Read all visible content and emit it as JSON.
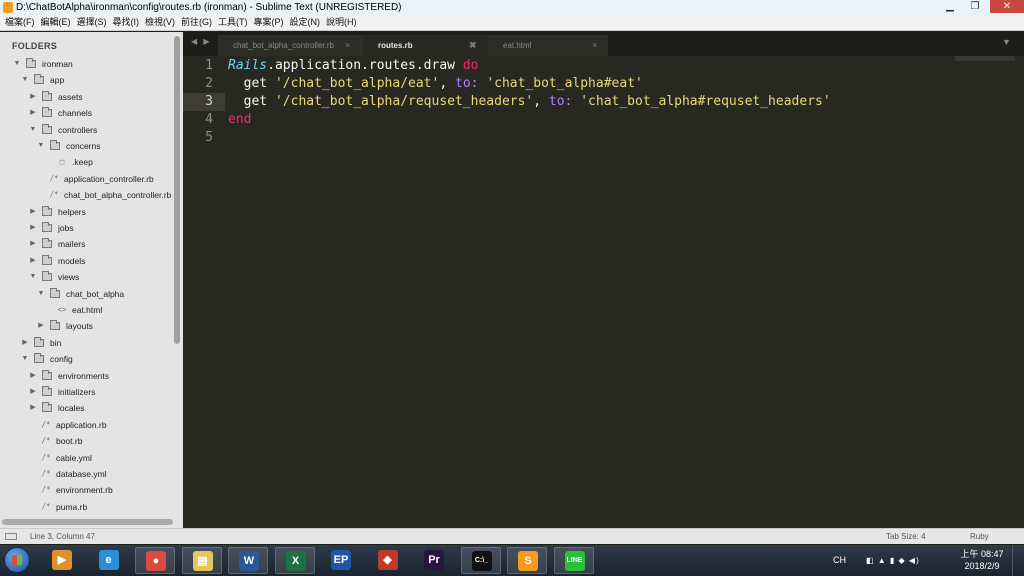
{
  "window": {
    "title": "D:\\ChatBotAlpha\\ironman\\config\\routes.rb (ironman) - Sublime Text (UNREGISTERED)",
    "minimize": "▁",
    "maximize": "❐",
    "close": "✕"
  },
  "menu": [
    "檔案(F)",
    "編輯(E)",
    "選擇(S)",
    "尋找(I)",
    "檢視(V)",
    "前往(G)",
    "工具(T)",
    "專案(P)",
    "設定(N)",
    "說明(H)"
  ],
  "sidebar": {
    "header": "FOLDERS",
    "tree": [
      {
        "label": "ironman",
        "depth": 0,
        "kind": "folder",
        "expanded": true
      },
      {
        "label": "app",
        "depth": 1,
        "kind": "folder",
        "expanded": true
      },
      {
        "label": "assets",
        "depth": 2,
        "kind": "folder",
        "expanded": false
      },
      {
        "label": "channels",
        "depth": 2,
        "kind": "folder",
        "expanded": false
      },
      {
        "label": "controllers",
        "depth": 2,
        "kind": "folder",
        "expanded": true
      },
      {
        "label": "concerns",
        "depth": 3,
        "kind": "folder",
        "expanded": true
      },
      {
        "label": ".keep",
        "depth": 4,
        "kind": "file",
        "icon": "□"
      },
      {
        "label": "application_controller.rb",
        "depth": 3,
        "kind": "file",
        "icon": "/*"
      },
      {
        "label": "chat_bot_alpha_controller.rb",
        "depth": 3,
        "kind": "file",
        "icon": "/*"
      },
      {
        "label": "helpers",
        "depth": 2,
        "kind": "folder",
        "expanded": false
      },
      {
        "label": "jobs",
        "depth": 2,
        "kind": "folder",
        "expanded": false
      },
      {
        "label": "mailers",
        "depth": 2,
        "kind": "folder",
        "expanded": false
      },
      {
        "label": "models",
        "depth": 2,
        "kind": "folder",
        "expanded": false
      },
      {
        "label": "views",
        "depth": 2,
        "kind": "folder",
        "expanded": true
      },
      {
        "label": "chat_bot_alpha",
        "depth": 3,
        "kind": "folder",
        "expanded": true
      },
      {
        "label": "eat.html",
        "depth": 4,
        "kind": "file",
        "icon": "<>"
      },
      {
        "label": "layouts",
        "depth": 3,
        "kind": "folder",
        "expanded": false
      },
      {
        "label": "bin",
        "depth": 1,
        "kind": "folder",
        "expanded": false
      },
      {
        "label": "config",
        "depth": 1,
        "kind": "folder",
        "expanded": true
      },
      {
        "label": "environments",
        "depth": 2,
        "kind": "folder",
        "expanded": false
      },
      {
        "label": "initializers",
        "depth": 2,
        "kind": "folder",
        "expanded": false
      },
      {
        "label": "locales",
        "depth": 2,
        "kind": "folder",
        "expanded": false
      },
      {
        "label": "application.rb",
        "depth": 2,
        "kind": "file",
        "icon": "/*"
      },
      {
        "label": "boot.rb",
        "depth": 2,
        "kind": "file",
        "icon": "/*"
      },
      {
        "label": "cable.yml",
        "depth": 2,
        "kind": "file",
        "icon": "/*"
      },
      {
        "label": "database.yml",
        "depth": 2,
        "kind": "file",
        "icon": "/*"
      },
      {
        "label": "environment.rb",
        "depth": 2,
        "kind": "file",
        "icon": "/*"
      },
      {
        "label": "puma.rb",
        "depth": 2,
        "kind": "file",
        "icon": "/*"
      }
    ]
  },
  "tabs": {
    "nav": "◀ ▶",
    "menu_glyph": "▼",
    "items": [
      {
        "label": "chat_bot_alpha_controller.rb",
        "active": false,
        "close": "×"
      },
      {
        "label": "routes.rb",
        "active": true,
        "close": "✖"
      },
      {
        "label": "eat.html",
        "active": false,
        "close": "×"
      }
    ]
  },
  "editor": {
    "line_numbers": [
      "1",
      "2",
      "3",
      "4",
      "5"
    ],
    "current_line": 3,
    "lines": [
      [
        {
          "t": "Rails",
          "c": "class"
        },
        {
          "t": ".application.routes.draw ",
          "c": "plain"
        },
        {
          "t": "do",
          "c": "kw"
        }
      ],
      [
        {
          "t": "  get ",
          "c": "plain"
        },
        {
          "t": "'/chat_bot_alpha/eat'",
          "c": "str"
        },
        {
          "t": ", ",
          "c": "plain"
        },
        {
          "t": "to:",
          "c": "sym"
        },
        {
          "t": " ",
          "c": "plain"
        },
        {
          "t": "'chat_bot_alpha#eat'",
          "c": "str"
        }
      ],
      [
        {
          "t": "  get ",
          "c": "plain"
        },
        {
          "t": "'/chat_bot_alpha/requset_headers'",
          "c": "str"
        },
        {
          "t": ", ",
          "c": "plain"
        },
        {
          "t": "to:",
          "c": "sym"
        },
        {
          "t": " ",
          "c": "plain"
        },
        {
          "t": "'chat_bot_alpha#requset_headers'",
          "c": "str"
        }
      ],
      [
        {
          "t": "end",
          "c": "kw"
        }
      ],
      []
    ]
  },
  "status": {
    "position": "Line 3, Column 47",
    "tab_size": "Tab Size: 4",
    "syntax": "Ruby"
  },
  "taskbar": {
    "apps": [
      {
        "name": "media-player-icon",
        "glyph": "▶",
        "color": "#e0902a",
        "open": false
      },
      {
        "name": "internet-explorer-icon",
        "glyph": "e",
        "color": "#2a8fd8",
        "open": false
      },
      {
        "name": "chrome-icon",
        "glyph": "●",
        "color": "#d94b3c",
        "open": true
      },
      {
        "name": "file-explorer-icon",
        "glyph": "▤",
        "color": "#e7c55b",
        "open": true
      },
      {
        "name": "word-icon",
        "glyph": "W",
        "color": "#2b5797",
        "open": true
      },
      {
        "name": "excel-icon",
        "glyph": "X",
        "color": "#1e7145",
        "open": true
      },
      {
        "name": "ep-app-icon",
        "glyph": "EP",
        "color": "#2255aa",
        "open": false
      },
      {
        "name": "network-app-icon",
        "glyph": "◆",
        "color": "#c0392b",
        "open": false
      },
      {
        "name": "premiere-icon",
        "glyph": "Pr",
        "color": "#2a1440",
        "open": false
      },
      {
        "name": "terminal-icon",
        "glyph": "C:\\_",
        "color": "#111111",
        "open": true
      },
      {
        "name": "sublime-icon",
        "glyph": "S",
        "color": "#f89a1e",
        "open": true
      },
      {
        "name": "line-icon",
        "glyph": "LINE",
        "color": "#2dbe3a",
        "open": true
      }
    ],
    "tray": {
      "lang": "CH",
      "icons": "◧ ▲ ▮ ◆ ◀)"
    },
    "clock_time": "上午 08:47",
    "clock_date": "2018/2/9"
  }
}
